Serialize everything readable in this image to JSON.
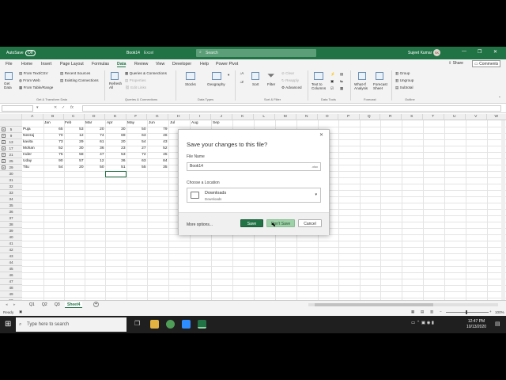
{
  "titlebar": {
    "autosave": "AutoSave",
    "autosave_state": "Off",
    "filename": "Book14",
    "app": "Excel",
    "search_placeholder": "Search",
    "user": "Sujeet Kumar",
    "user_initials": "SK"
  },
  "tabs": [
    "File",
    "Home",
    "Insert",
    "Page Layout",
    "Formulas",
    "Data",
    "Review",
    "View",
    "Developer",
    "Help",
    "Power Pivot"
  ],
  "active_tab": "Data",
  "share_label": "Share",
  "comments_label": "Comments",
  "ribbon": {
    "get_data": "Get Data",
    "from_text": "From Text/CSV",
    "from_web": "From Web",
    "from_table": "From Table/Range",
    "recent_sources": "Recent Sources",
    "existing_connections": "Existing Connections",
    "group_get": "Get & Transform Data",
    "refresh_all": "Refresh All",
    "queries_connections": "Queries & Connections",
    "properties": "Properties",
    "edit_links": "Edit Links",
    "group_queries": "Queries & Connections",
    "stocks": "Stocks",
    "geography": "Geography",
    "group_types": "Data Types",
    "sort": "Sort",
    "filter": "Filter",
    "clear": "Clear",
    "reapply": "Reapply",
    "advanced": "Advanced",
    "group_sort": "Sort & Filter",
    "text_to_columns": "Text to Columns",
    "group_tools": "Data Tools",
    "what_if": "What-If Analysis",
    "forecast_sheet": "Forecast Sheet",
    "group_forecast": "Forecast",
    "group": "Group",
    "ungroup": "Ungroup",
    "subtotal": "Subtotal",
    "group_outline": "Outline"
  },
  "columns": [
    "A",
    "B",
    "C",
    "D",
    "E",
    "F",
    "G",
    "H",
    "I",
    "J",
    "K",
    "L",
    "M",
    "N",
    "O",
    "P",
    "Q",
    "R",
    "S",
    "T",
    "U",
    "V",
    "W"
  ],
  "header_row": [
    "Jan",
    "Feb",
    "Mar",
    "Apr",
    "May",
    "Jun",
    "Jul",
    "Aug",
    "Sep"
  ],
  "rows": [
    {
      "num": "5",
      "name": "Puja",
      "values": [
        "65",
        "53",
        "20",
        "30",
        "50",
        "79"
      ]
    },
    {
      "num": "9",
      "name": "Neeraj",
      "values": [
        "70",
        "12",
        "74",
        "69",
        "63",
        "46"
      ]
    },
    {
      "num": "13",
      "name": "kavita",
      "values": [
        "73",
        "29",
        "61",
        "20",
        "54",
        "43"
      ]
    },
    {
      "num": "17",
      "name": "Mohan",
      "values": [
        "52",
        "30",
        "36",
        "23",
        "27",
        "52"
      ]
    },
    {
      "num": "21",
      "name": "Inder",
      "values": [
        "75",
        "58",
        "47",
        "53",
        "72",
        "45"
      ]
    },
    {
      "num": "25",
      "name": "Uday",
      "values": [
        "90",
        "57",
        "12",
        "36",
        "63",
        "84"
      ]
    },
    {
      "num": "29",
      "name": "Titu",
      "values": [
        "54",
        "20",
        "50",
        "51",
        "55",
        "35"
      ]
    }
  ],
  "empty_rows": [
    "30",
    "31",
    "32",
    "33",
    "34",
    "35",
    "36",
    "37",
    "38",
    "39",
    "40",
    "41",
    "42",
    "43",
    "44",
    "45",
    "46",
    "47",
    "48",
    "49",
    "50",
    "51",
    "52",
    "53",
    "54",
    "55",
    "56"
  ],
  "sheets": [
    "Q1",
    "Q2",
    "Q3",
    "Sheet4"
  ],
  "active_sheet": "Sheet4",
  "status": {
    "ready": "Ready",
    "zoom": "100%"
  },
  "taskbar": {
    "search_placeholder": "Type here to search",
    "time": "12:47 PM",
    "date": "10/13/2020"
  },
  "dialog": {
    "title": "Save your changes to this file?",
    "file_name_label": "File Name",
    "file_name": "Book14",
    "ext": ".xlsx",
    "location_label": "Choose a Location",
    "location_name": "Downloads",
    "location_sub": "Downloads",
    "more_options": "More options...",
    "save": "Save",
    "dont_save": "Don't Save",
    "cancel": "Cancel"
  },
  "colors": {
    "excel_green": "#217346",
    "dont_save_bg": "#9fd1a8"
  }
}
